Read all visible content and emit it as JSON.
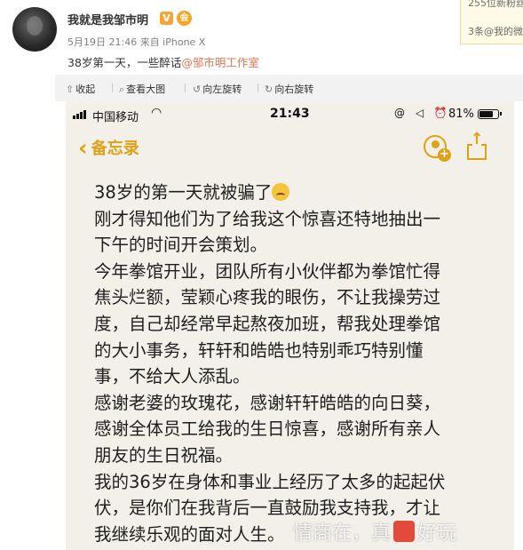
{
  "post": {
    "username": "我就是我邹市明",
    "verified_badge": "V",
    "member_badge": "会",
    "meta": "5月19日 21:46 来自 iPhone X",
    "text_prefix": "38岁第一天，一些醉话",
    "mention": "@邹市明工作室"
  },
  "notification": {
    "line1": "255位新粉丝",
    "line2": "3条@我的微"
  },
  "toolbar": {
    "items": [
      {
        "icon": "collapse-icon",
        "glyph": "⇧",
        "label": "收起"
      },
      {
        "icon": "zoom-icon",
        "glyph": "⌕",
        "label": "查看大图"
      },
      {
        "icon": "rotate-left-icon",
        "glyph": "↺",
        "label": "向左旋转"
      },
      {
        "icon": "rotate-right-icon",
        "glyph": "↻",
        "label": "向右旋转"
      }
    ]
  },
  "phone": {
    "carrier": "中国移动",
    "time": "21:43",
    "battery_percent": "81%",
    "battery_level": 0.81,
    "status_icons": "@ ◁ ⏰",
    "back_label": "备忘录",
    "note_lines": [
      "38岁的第一天就被骗了",
      "刚才得知他们为了给我这个惊喜还特地抽出一",
      "下午的时间开会策划。",
      "今年拳馆开业，团队所有小伙伴都为拳馆忙得",
      "焦头烂额，莹颖心疼我的眼伤，不让我操劳过",
      "度，自己却经常早起熬夜加班，帮我处理拳馆",
      "的大小事务，轩轩和皓皓也特别乖巧特别懂",
      "事，不给大人添乱。",
      "感谢老婆的玫瑰花，感谢轩轩皓皓的向日葵，",
      "感谢全体员工给我的生日惊喜，感谢所有亲人",
      "朋友的生日祝福。",
      "我的36岁在身体和事业上经历了太多的起起伏",
      "伏，是你们在我背后一直鼓励我支持我，才让",
      "我继续乐观的面对人生。"
    ]
  },
  "watermark": {
    "text_before": "情商在，真",
    "text_after": "好玩"
  },
  "colors": {
    "accent": "#e0a114",
    "mention": "#eb7350",
    "toolbar_bg": "#f2f2f2",
    "note_bg": "#f3f0ea"
  }
}
